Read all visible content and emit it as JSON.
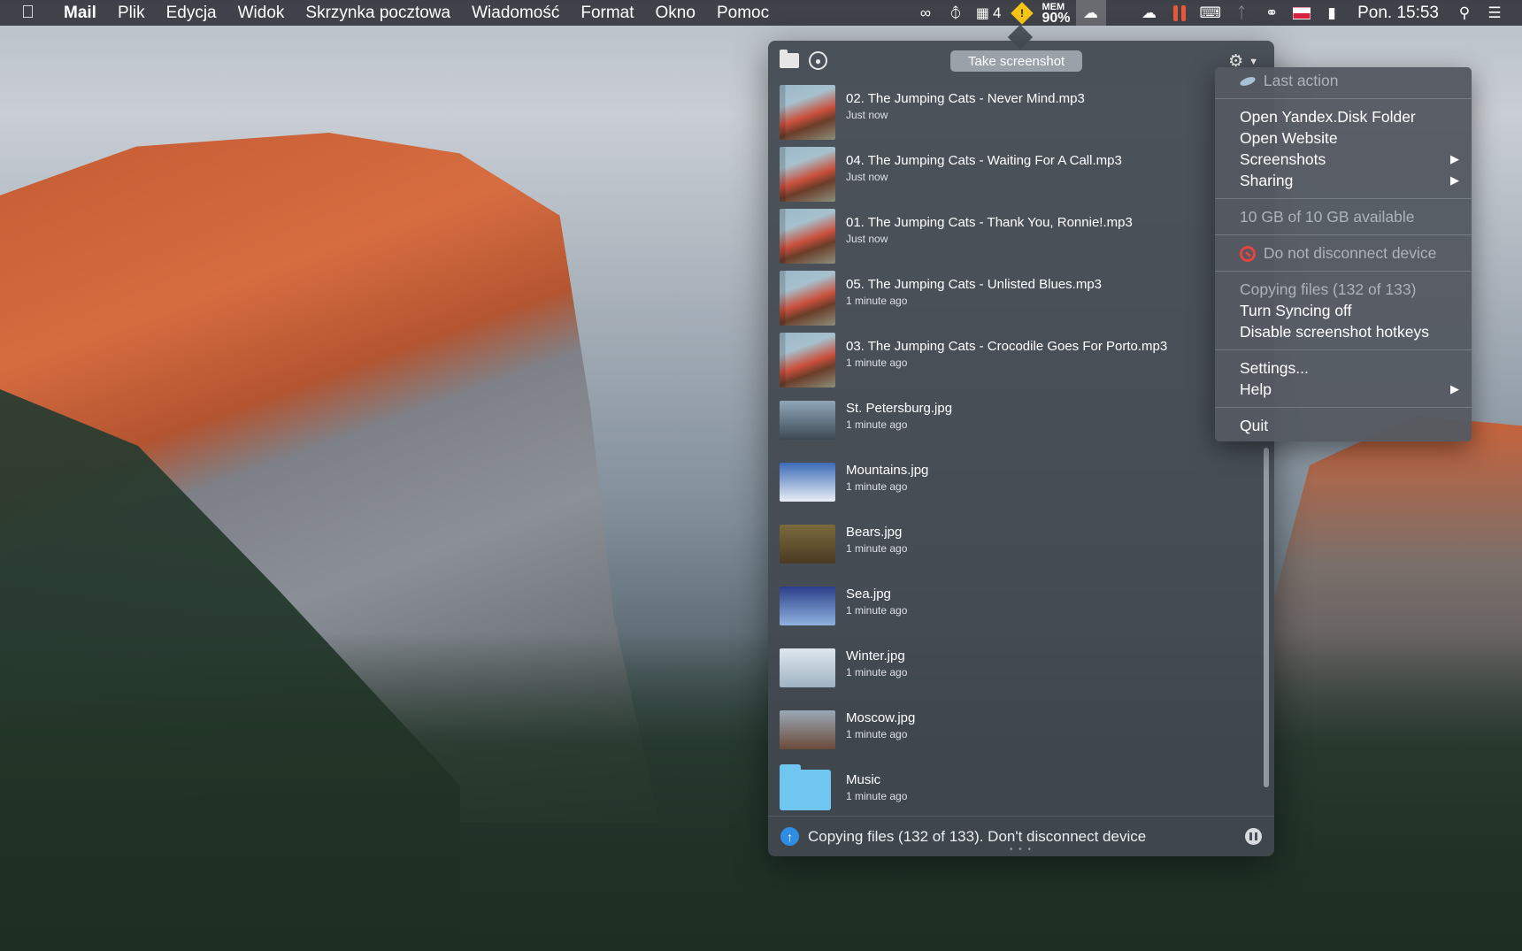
{
  "menubar": {
    "apple_icon": "apple-icon",
    "app_name": "Mail",
    "menus": [
      "Plik",
      "Edycja",
      "Widok",
      "Skrzynka pocztowa",
      "Wiadomość",
      "Format",
      "Okno",
      "Pomoc"
    ],
    "status": {
      "badge_count": "4",
      "mem_label": "MEM",
      "mem_value": "90%",
      "clock": "Pon. 15:53"
    }
  },
  "popover": {
    "take_screenshot_label": "Take screenshot",
    "files": [
      {
        "name": "02. The Jumping Cats - Never Mind.mp3",
        "time": "Just now",
        "kind": "music"
      },
      {
        "name": "04. The Jumping Cats - Waiting For A Call.mp3",
        "time": "Just now",
        "kind": "music"
      },
      {
        "name": "01. The Jumping Cats - Thank You, Ronnie!.mp3",
        "time": "Just now",
        "kind": "music"
      },
      {
        "name": "05. The Jumping Cats - Unlisted Blues.mp3",
        "time": "1 minute ago",
        "kind": "music"
      },
      {
        "name": "03. The Jumping Cats - Crocodile Goes For Porto.mp3",
        "time": "1 minute ago",
        "kind": "music"
      },
      {
        "name": "St. Petersburg.jpg",
        "time": "1 minute ago",
        "kind": "photo",
        "colors": [
          "#8fa6b8",
          "#3d4a55"
        ]
      },
      {
        "name": "Mountains.jpg",
        "time": "1 minute ago",
        "kind": "photo",
        "colors": [
          "#3b6bb8",
          "#e9eef4"
        ]
      },
      {
        "name": "Bears.jpg",
        "time": "1 minute ago",
        "kind": "photo",
        "colors": [
          "#7b6a3c",
          "#4a3b22"
        ]
      },
      {
        "name": "Sea.jpg",
        "time": "1 minute ago",
        "kind": "photo",
        "colors": [
          "#2a3f8a",
          "#8fb2e0"
        ]
      },
      {
        "name": "Winter.jpg",
        "time": "1 minute ago",
        "kind": "photo",
        "colors": [
          "#dfe7ee",
          "#9fb3c3"
        ]
      },
      {
        "name": "Moscow.jpg",
        "time": "1 minute ago",
        "kind": "photo",
        "colors": [
          "#9aa8b6",
          "#6b4b3a"
        ]
      },
      {
        "name": "Music",
        "time": "1 minute ago",
        "kind": "folder"
      }
    ],
    "footer_text": "Copying files (132 of 133). Don't disconnect device"
  },
  "dropdown": {
    "last_action": "Last action",
    "open_folder": "Open Yandex.Disk Folder",
    "open_website": "Open Website",
    "screenshots": "Screenshots",
    "sharing": "Sharing",
    "storage": "10 GB of 10 GB available",
    "do_not_disconnect": "Do not disconnect device",
    "copying_status": "Copying files (132 of 133)",
    "turn_syncing_off": "Turn Syncing off",
    "disable_hotkeys": "Disable screenshot hotkeys",
    "settings": "Settings...",
    "help": "Help",
    "quit": "Quit",
    "submenu_arrow": "▶"
  },
  "colors": {
    "accent_upload": "#2f8de4",
    "folder_blue": "#6ec6f1",
    "warning_red": "#e0463e"
  }
}
